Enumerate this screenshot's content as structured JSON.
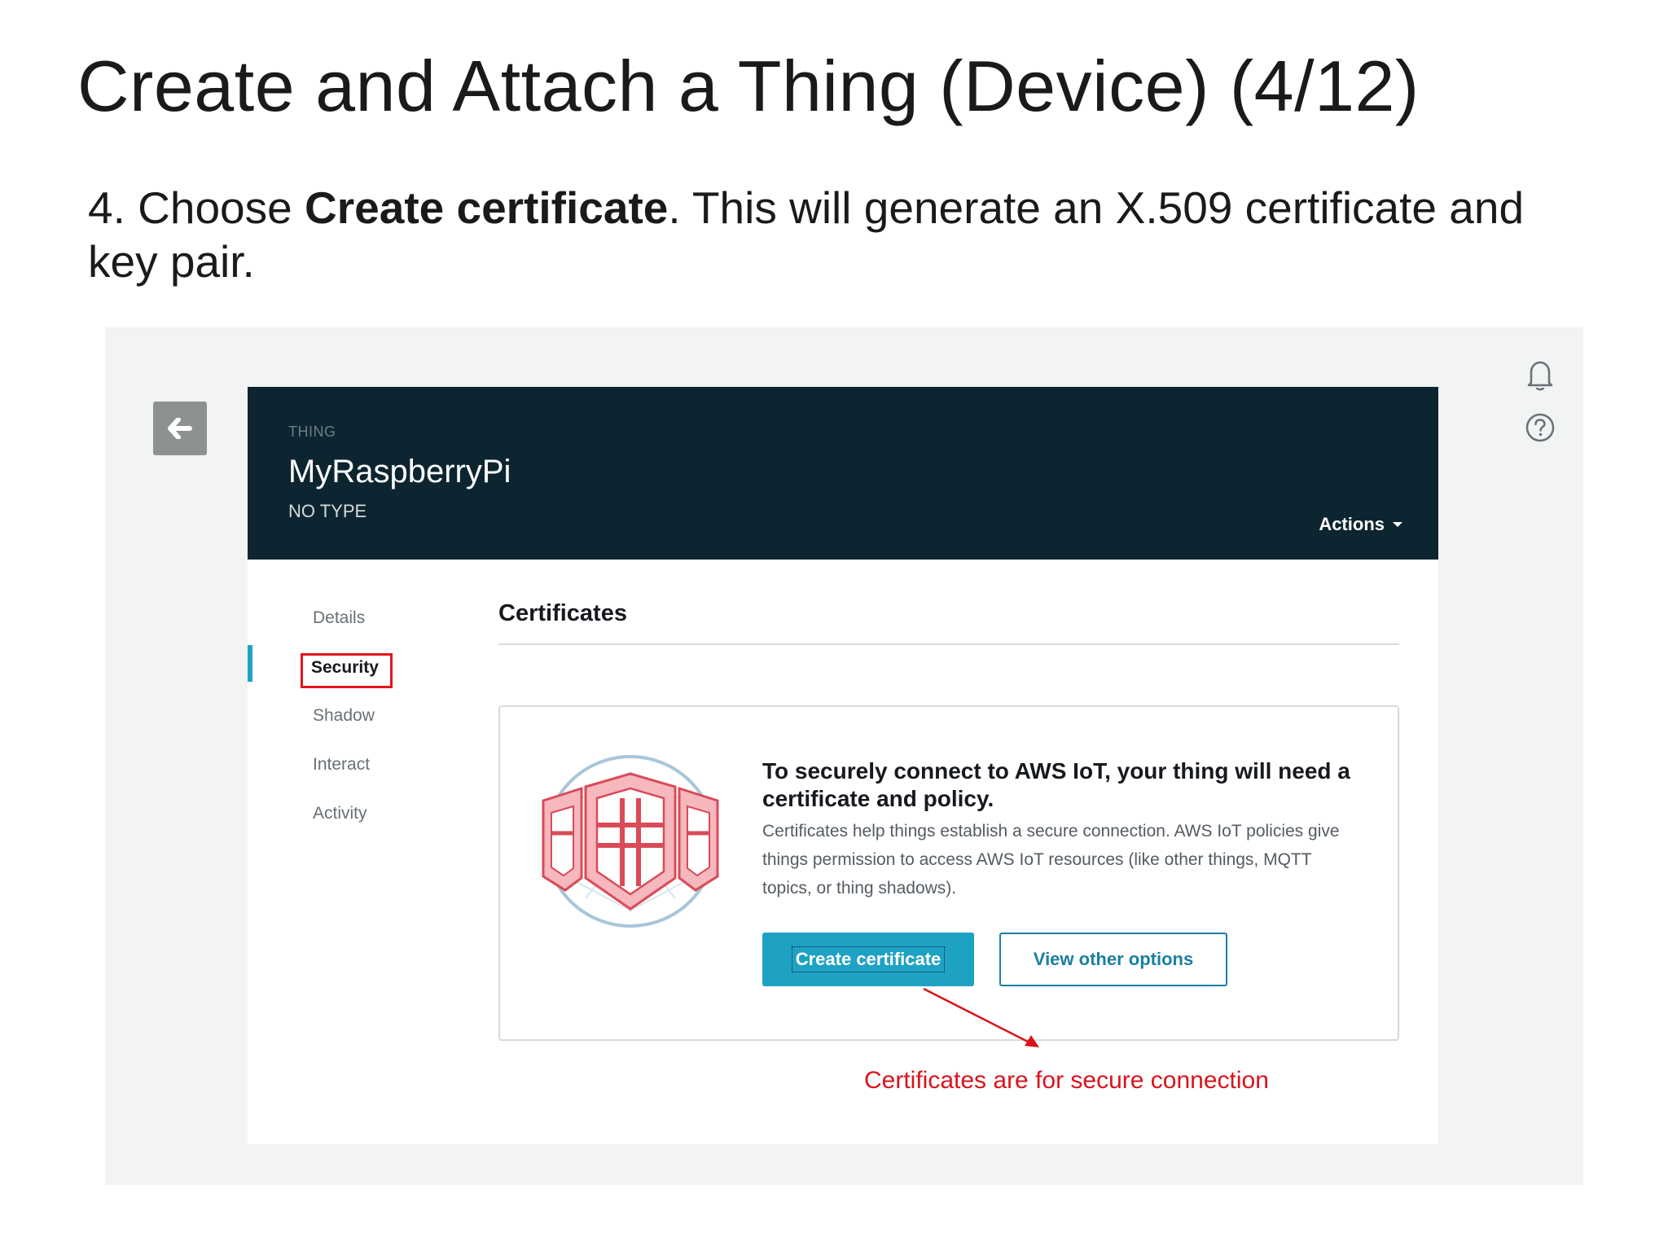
{
  "slide": {
    "title": "Create and Attach a Thing (Device) (4/12)",
    "instruction_prefix": "4. Choose ",
    "instruction_bold": "Create certificate",
    "instruction_suffix": ". This will generate an X.509 certificate and key pair."
  },
  "console": {
    "back_icon": "arrow-left-icon",
    "header": {
      "label": "THING",
      "name": "MyRaspberryPi",
      "type": "NO TYPE",
      "actions_label": "Actions"
    },
    "utility_icons": [
      "bell-icon",
      "help-circle-icon"
    ],
    "nav": {
      "items": [
        "Details",
        "Security",
        "Shadow",
        "Interact",
        "Activity"
      ],
      "active": "Security"
    },
    "section_title": "Certificates",
    "card": {
      "illustration": "shield-certificate-icon",
      "heading": "To securely connect to AWS IoT, your thing will need a certificate and policy.",
      "body": "Certificates help things establish a secure connection. AWS IoT policies give things permission to access AWS IoT resources (like other things, MQTT topics, or thing shadows).",
      "primary_button": "Create certificate",
      "secondary_button": "View other options"
    }
  },
  "annotation": {
    "text": "Certificates are for secure connection",
    "color": "#d9141b"
  },
  "colors": {
    "header_bg": "#0d2530",
    "accent": "#1ea2c4",
    "highlight": "#e3141c"
  }
}
